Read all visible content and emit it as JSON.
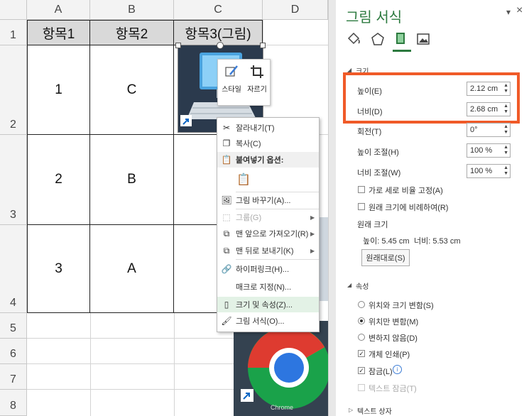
{
  "sheet": {
    "columns": [
      "A",
      "B",
      "C",
      "D"
    ],
    "rows": [
      "1",
      "2",
      "3",
      "4",
      "5",
      "6",
      "7",
      "8"
    ],
    "header_row": [
      "항목1",
      "항목2",
      "항목3(그림)"
    ],
    "data_rows": [
      [
        "1",
        "C"
      ],
      [
        "2",
        "B"
      ],
      [
        "3",
        "A"
      ]
    ]
  },
  "mini_toolbar": {
    "style_label": "스타일",
    "crop_label": "자르기"
  },
  "chrome_caption": "Chrome",
  "context_menu": {
    "items": [
      {
        "label": "잘라내기(T)",
        "icon": "scissors-icon"
      },
      {
        "label": "복사(C)",
        "icon": "copy-icon"
      },
      {
        "label": "붙여넣기 옵션:",
        "icon": "paste-icon"
      },
      {
        "label": "",
        "icon": "paste-option-icon"
      },
      {
        "label": "그림 바꾸기(A)...",
        "icon": "change-picture-icon"
      },
      {
        "label": "그룹(G)",
        "icon": "group-icon"
      },
      {
        "label": "맨 앞으로 가져오기(R)",
        "icon": "bring-front-icon"
      },
      {
        "label": "맨 뒤로 보내기(K)",
        "icon": "send-back-icon"
      },
      {
        "label": "하이퍼링크(H)...",
        "icon": "hyperlink-icon"
      },
      {
        "label": "매크로 지정(N)...",
        "icon": ""
      },
      {
        "label": "크기 및 속성(Z)...",
        "icon": "size-properties-icon"
      },
      {
        "label": "그림 서식(O)...",
        "icon": "format-picture-icon"
      }
    ]
  },
  "pane": {
    "title": "그림 서식",
    "dropdown_icon": "▾",
    "close_icon": "×",
    "section_size": "크기",
    "height_label": "높이(E)",
    "height_value": "2.12 cm",
    "width_label": "너비(D)",
    "width_value": "2.68 cm",
    "rotation_label": "회전(T)",
    "rotation_value": "0°",
    "scale_height_label": "높이 조절(H)",
    "scale_height_value": "100 %",
    "scale_width_label": "너비 조절(W)",
    "scale_width_value": "100 %",
    "lock_aspect_label": "가로 세로 비율 고정(A)",
    "relative_label": "원래 크기에 비례하여(R)",
    "original_size_label": "원래 크기",
    "original_height": "높이:   5.45 cm",
    "original_width": "너비:   5.53 cm",
    "reset_button": "원래대로(S)",
    "section_properties": "속성",
    "radio_move_size": "위치와 크기 변함(S)",
    "radio_move_only": "위치만 변함(M)",
    "radio_none": "변하지 않음(D)",
    "print_object": "개체 인쇄(P)",
    "locked": "잠금(L)",
    "lock_text": "텍스트 잠금(T)",
    "section_textbox": "텍스트 상자"
  },
  "colors": {
    "highlight_box": "#f05a28",
    "header_fill": "#d9d9d9",
    "grid": "#d4d4d4",
    "menu_highlight": "#e3f2e6"
  }
}
